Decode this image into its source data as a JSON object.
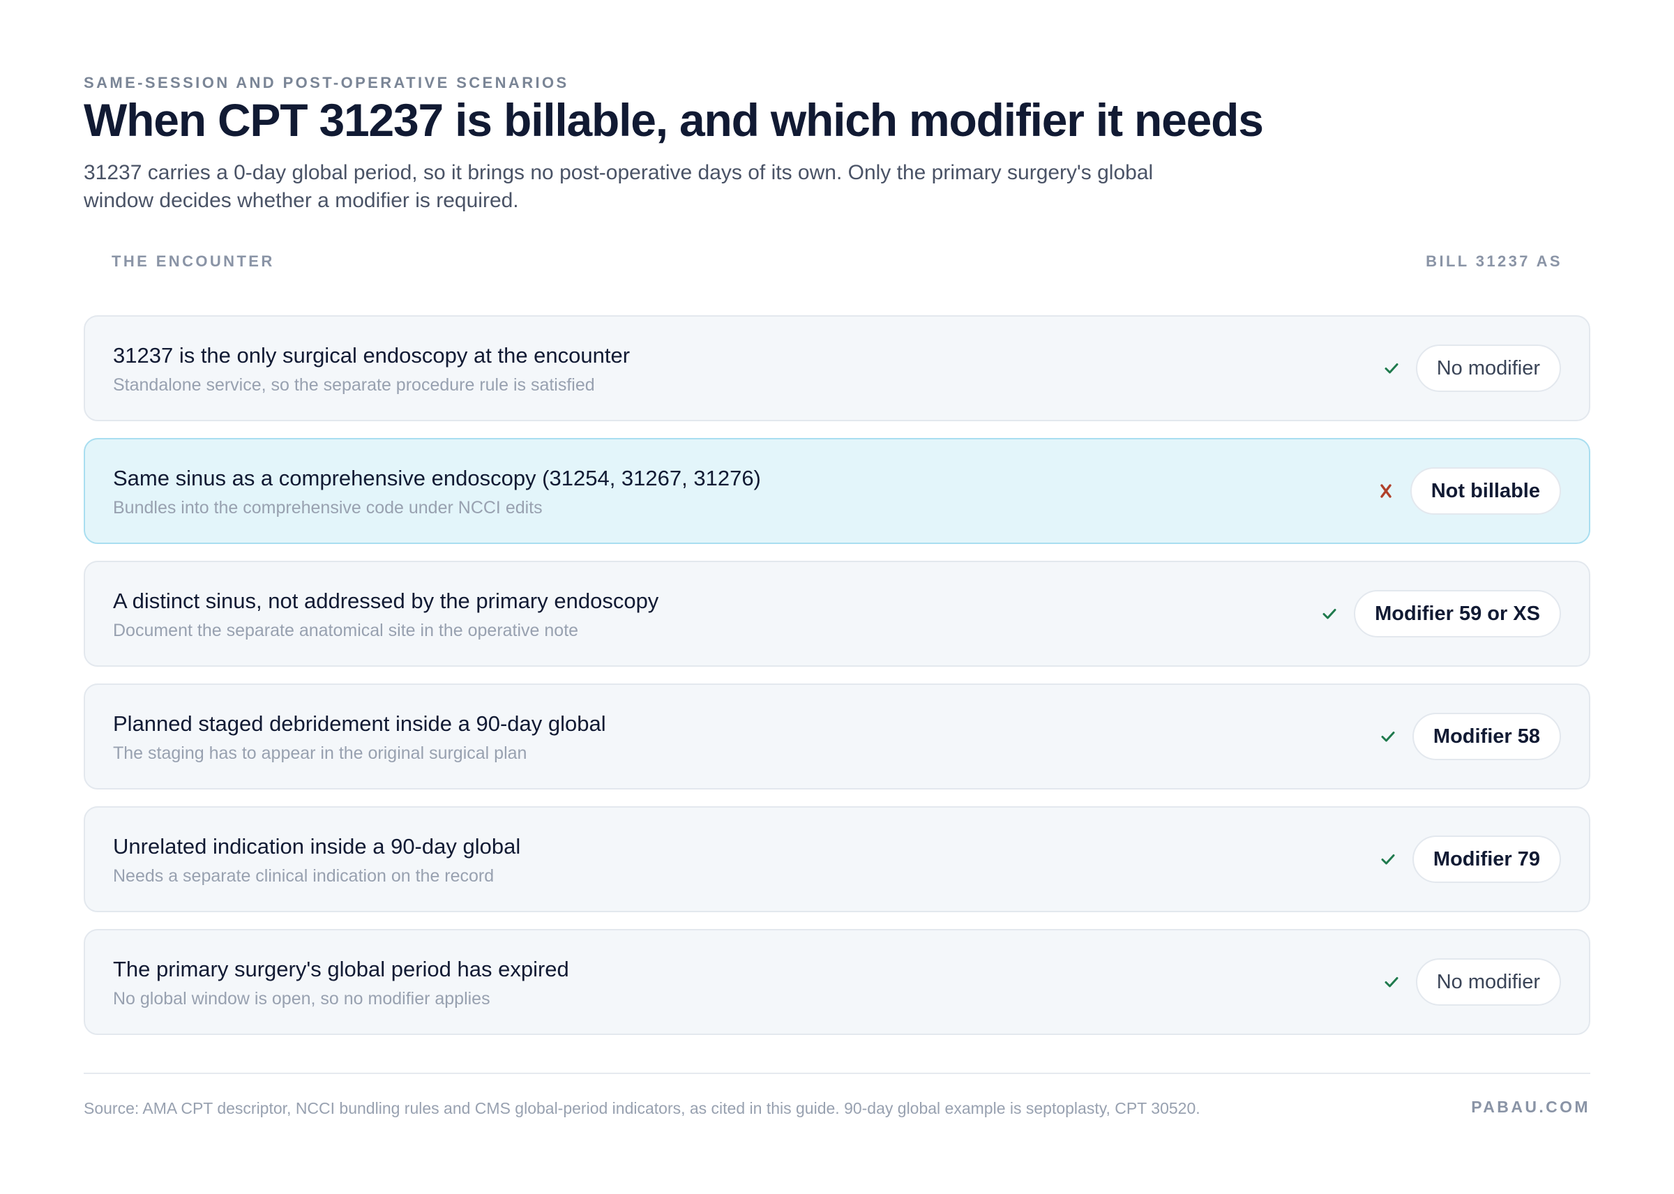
{
  "header": {
    "eyebrow": "SAME-SESSION AND POST-OPERATIVE SCENARIOS",
    "title": "When CPT 31237 is billable, and which modifier it needs",
    "intro": "31237 carries a 0-day global period, so it brings no post-operative days of its own. Only the primary surgery's global window decides whether a modifier is required."
  },
  "columns": {
    "left": "THE ENCOUNTER",
    "right": "BILL 31237 AS"
  },
  "rows": [
    {
      "title": "31237 is the only surgical endoscopy at the encounter",
      "subtitle": "Standalone service, so the separate procedure rule is satisfied",
      "status": "check",
      "status_icon": "check-icon",
      "result": "No modifier",
      "result_emphasis": false,
      "highlight": false
    },
    {
      "title": "Same sinus as a comprehensive endoscopy (31254, 31267, 31276)",
      "subtitle": "Bundles into the comprehensive code under NCCI edits",
      "status": "cross",
      "status_icon": "cross-icon",
      "result": "Not billable",
      "result_emphasis": true,
      "highlight": true
    },
    {
      "title": "A distinct sinus, not addressed by the primary endoscopy",
      "subtitle": "Document the separate anatomical site in the operative note",
      "status": "check",
      "status_icon": "check-icon",
      "result": "Modifier 59 or XS",
      "result_emphasis": true,
      "highlight": false
    },
    {
      "title": "Planned staged debridement inside a 90-day global",
      "subtitle": "The staging has to appear in the original surgical plan",
      "status": "check",
      "status_icon": "check-icon",
      "result": "Modifier 58",
      "result_emphasis": true,
      "highlight": false
    },
    {
      "title": "Unrelated indication inside a 90-day global",
      "subtitle": "Needs a separate clinical indication on the record",
      "status": "check",
      "status_icon": "check-icon",
      "result": "Modifier 79",
      "result_emphasis": true,
      "highlight": false
    },
    {
      "title": "The primary surgery's global period has expired",
      "subtitle": "No global window is open, so no modifier applies",
      "status": "check",
      "status_icon": "check-icon",
      "result": "No modifier",
      "result_emphasis": false,
      "highlight": false
    }
  ],
  "footer": {
    "source": "Source: AMA CPT descriptor, NCCI bundling rules and CMS global-period indicators, as cited in this guide. 90-day global example is septoplasty, CPT 30520.",
    "brand": "PABAU.COM"
  },
  "colors": {
    "check": "#1f7a4d",
    "cross": "#b0402a",
    "highlight_bg": "#e3f5fa",
    "row_bg": "#f4f7fa",
    "title": "#111a33"
  }
}
